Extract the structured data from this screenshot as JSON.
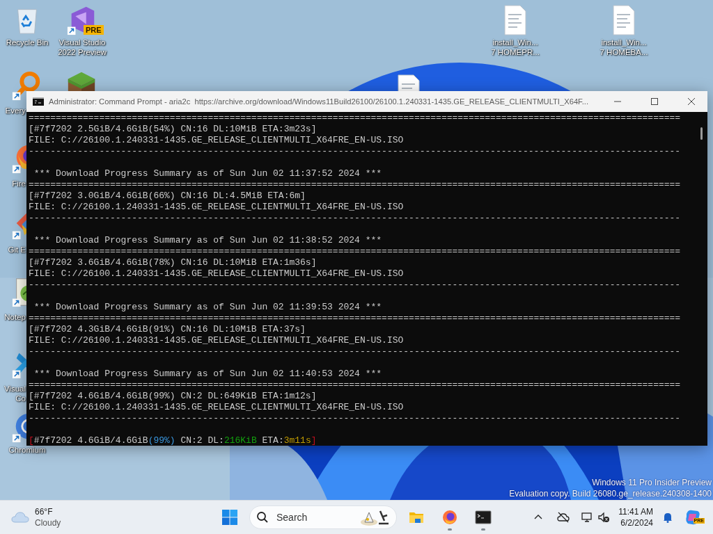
{
  "desktop_icons": [
    {
      "kind": "recycle-bin",
      "lines": [
        "Recycle Bin"
      ]
    },
    {
      "kind": "visual-studio",
      "badge": "PRE",
      "lines": [
        "Visual Studio",
        "2022 Preview"
      ]
    },
    {
      "kind": "document",
      "lines": [
        "install_Win...",
        "7 HOMEPR..."
      ]
    },
    {
      "kind": "document",
      "lines": [
        "install_Win...",
        "7 HOMEBA..."
      ]
    },
    {
      "kind": "document"
    },
    {
      "kind": "everything",
      "lines": [
        "Every"
      ]
    },
    {
      "kind": "grass-block"
    },
    {
      "kind": "firefox",
      "lines": [
        "Fire"
      ]
    },
    {
      "kind": "git",
      "lines": [
        "Git E"
      ]
    },
    {
      "kind": "notepad",
      "lines": [
        "Notep"
      ]
    },
    {
      "kind": "vscode",
      "lines": [
        "Visual",
        "Co"
      ]
    },
    {
      "kind": "chromium",
      "lines": [
        "Chromium"
      ]
    }
  ],
  "console_window": {
    "title": "Administrator: Command Prompt - aria2c  https://archive.org/download/Windows11Build26100/26100.1.240331-1435.GE_RELEASE_CLIENTMULTI_X64F...",
    "lines": [
      {
        "kind": "text",
        "text": "========================================================================================================================"
      },
      {
        "kind": "text",
        "text": "[#7f7202 2.5GiB/4.6GiB(54%) CN:16 DL:10MiB ETA:3m23s]"
      },
      {
        "kind": "text",
        "text": "FILE: C://26100.1.240331-1435.GE_RELEASE_CLIENTMULTI_X64FRE_EN-US.ISO"
      },
      {
        "kind": "text",
        "text": "------------------------------------------------------------------------------------------------------------------------"
      },
      {
        "kind": "blank"
      },
      {
        "kind": "text",
        "text": " *** Download Progress Summary as of Sun Jun 02 11:37:52 2024 ***"
      },
      {
        "kind": "text",
        "text": "========================================================================================================================"
      },
      {
        "kind": "text",
        "text": "[#7f7202 3.0GiB/4.6GiB(66%) CN:16 DL:4.5MiB ETA:6m]"
      },
      {
        "kind": "text",
        "text": "FILE: C://26100.1.240331-1435.GE_RELEASE_CLIENTMULTI_X64FRE_EN-US.ISO"
      },
      {
        "kind": "text",
        "text": "------------------------------------------------------------------------------------------------------------------------"
      },
      {
        "kind": "blank"
      },
      {
        "kind": "text",
        "text": " *** Download Progress Summary as of Sun Jun 02 11:38:52 2024 ***"
      },
      {
        "kind": "text",
        "text": "========================================================================================================================"
      },
      {
        "kind": "text",
        "text": "[#7f7202 3.6GiB/4.6GiB(78%) CN:16 DL:10MiB ETA:1m36s]"
      },
      {
        "kind": "text",
        "text": "FILE: C://26100.1.240331-1435.GE_RELEASE_CLIENTMULTI_X64FRE_EN-US.ISO"
      },
      {
        "kind": "text",
        "text": "------------------------------------------------------------------------------------------------------------------------"
      },
      {
        "kind": "blank"
      },
      {
        "kind": "text",
        "text": " *** Download Progress Summary as of Sun Jun 02 11:39:53 2024 ***"
      },
      {
        "kind": "text",
        "text": "========================================================================================================================"
      },
      {
        "kind": "text",
        "text": "[#7f7202 4.3GiB/4.6GiB(91%) CN:16 DL:10MiB ETA:37s]"
      },
      {
        "kind": "text",
        "text": "FILE: C://26100.1.240331-1435.GE_RELEASE_CLIENTMULTI_X64FRE_EN-US.ISO"
      },
      {
        "kind": "text",
        "text": "------------------------------------------------------------------------------------------------------------------------"
      },
      {
        "kind": "blank"
      },
      {
        "kind": "text",
        "text": " *** Download Progress Summary as of Sun Jun 02 11:40:53 2024 ***"
      },
      {
        "kind": "text",
        "text": "========================================================================================================================"
      },
      {
        "kind": "text",
        "text": "[#7f7202 4.6GiB/4.6GiB(99%) CN:2 DL:649KiB ETA:1m12s]"
      },
      {
        "kind": "text",
        "text": "FILE: C://26100.1.240331-1435.GE_RELEASE_CLIENTMULTI_X64FRE_EN-US.ISO"
      },
      {
        "kind": "text",
        "text": "------------------------------------------------------------------------------------------------------------------------"
      },
      {
        "kind": "blank"
      },
      {
        "kind": "colored",
        "segments": [
          {
            "text": "[",
            "color": "#c50f1f"
          },
          {
            "text": "#7f7202 4.6GiB/4.6GiB",
            "color": "#cccccc"
          },
          {
            "text": "(99%)",
            "color": "#3a96dd"
          },
          {
            "text": " CN:2 DL:",
            "color": "#cccccc"
          },
          {
            "text": "216KiB",
            "color": "#13a10e"
          },
          {
            "text": " ETA:",
            "color": "#cccccc"
          },
          {
            "text": "3m11s",
            "color": "#c19c00"
          },
          {
            "text": "]",
            "color": "#c50f1f"
          }
        ]
      }
    ]
  },
  "watermark": [
    "Windows 11 Pro Insider Preview",
    "Evaluation copy. Build 26080.ge_release.240308-1400"
  ],
  "taskbar": {
    "weather": {
      "temperature": "66°F",
      "condition": "Cloudy"
    },
    "search": {
      "placeholder": "Search"
    },
    "apps": [
      {
        "kind": "file-explorer",
        "running": false
      },
      {
        "kind": "firefox",
        "running": true
      },
      {
        "kind": "terminal",
        "running": true
      }
    ],
    "clock": {
      "time": "11:41 AM",
      "date": "6/2/2024"
    },
    "copilot_badge": "PRE"
  }
}
